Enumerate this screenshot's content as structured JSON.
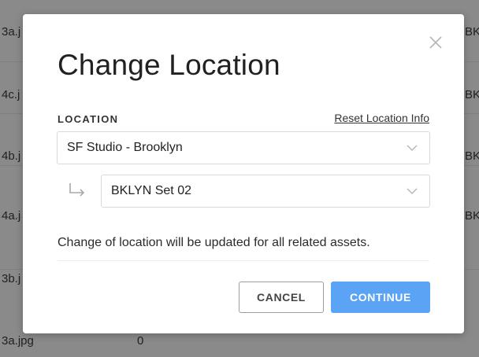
{
  "background_table": {
    "rows": [
      {
        "file": "3a.j",
        "count": "",
        "location": "BK"
      },
      {
        "file": "4c.j",
        "count": "",
        "location": "BK"
      },
      {
        "file": "4b.j",
        "count": "",
        "location": "BK"
      },
      {
        "file": "4a.j",
        "count": "",
        "location": "BK"
      },
      {
        "file": "3b.j",
        "count": "",
        "location": ""
      },
      {
        "file": "3a.jpg",
        "count": "0",
        "location": ""
      }
    ]
  },
  "modal": {
    "title": "Change Location",
    "close_icon": "close-icon",
    "location_label": "LOCATION",
    "reset_link": "Reset Location Info",
    "location_select": {
      "value": "SF Studio - Brooklyn"
    },
    "sublocation_select": {
      "value": "BKLYN Set 02"
    },
    "note": "Change of location will be updated for all related assets.",
    "cancel_label": "CANCEL",
    "continue_label": "CONTINUE"
  },
  "colors": {
    "overlay": "#8a8a8a",
    "accent": "#5ba4f5",
    "text": "#212121"
  }
}
